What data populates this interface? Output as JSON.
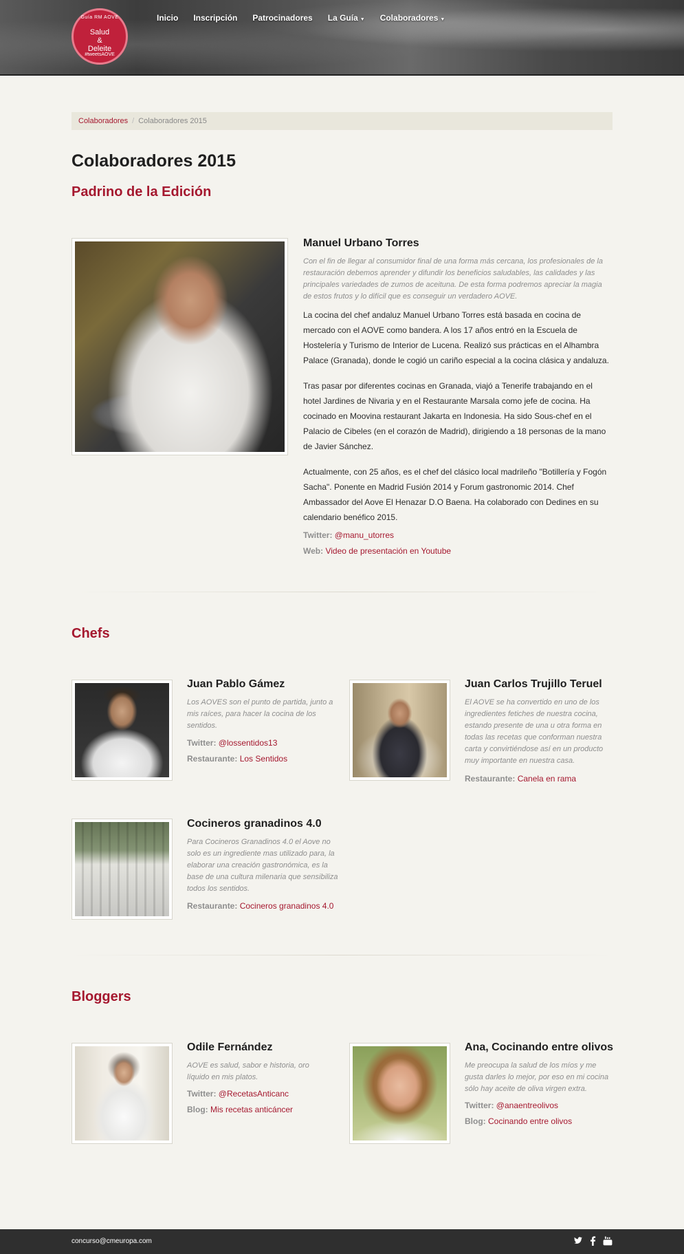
{
  "logo": {
    "top_text": "Guía RM AOVE",
    "line1": "Salud",
    "line2": "&",
    "line3": "Deleite",
    "bottom_text": "#tweetsAOVE"
  },
  "nav": [
    {
      "label": "Inicio"
    },
    {
      "label": "Inscripción"
    },
    {
      "label": "Patrocinadores"
    },
    {
      "label": "La Guía",
      "dropdown": true
    },
    {
      "label": "Colaboradores",
      "dropdown": true
    }
  ],
  "breadcrumb": {
    "link": "Colaboradores",
    "current": "Colaboradores 2015"
  },
  "page_title": "Colaboradores 2015",
  "sections": {
    "padrino": "Padrino de la Edición",
    "chefs": "Chefs",
    "bloggers": "Bloggers"
  },
  "featured": {
    "name": "Manuel Urbano Torres",
    "quote": "Con el fin de llegar al consumidor final de una forma más cercana, los profesionales de la restauración debemos aprender y difundir los beneficios saludables, las calidades y las principales variedades de zumos de aceituna. De esta forma podremos apreciar la magia de estos frutos y lo difícil que es conseguir un verdadero AOVE.",
    "p1": "La cocina del chef andaluz Manuel Urbano Torres está basada en cocina de mercado con el AOVE como bandera. A los 17 años entró en la Escuela de Hostelería y Turismo de Interior de Lucena. Realizó sus prácticas en el Alhambra Palace (Granada), donde le cogió un cariño especial a la cocina clásica y andaluza.",
    "p2": "Tras pasar por diferentes cocinas en Granada, viajó a Tenerife trabajando en el hotel Jardines de Nivaria y en el Restaurante Marsala como jefe de cocina. Ha cocinado en Moovina restaurant Jakarta en Indonesia. Ha sido Sous-chef en el Palacio de Cibeles (en el corazón de Madrid), dirigiendo a 18 personas de la mano de Javier Sánchez.",
    "p3": "Actualmente, con 25 años, es el chef del clásico local madrileño \"Botillería y Fogón Sacha\". Ponente en Madrid Fusión 2014 y Forum gastronomic 2014. Chef Ambassador del Aove El Henazar D.O Baena. Ha colaborado con Dedines en su calendario benéfico 2015.",
    "twitter_label": "Twitter:",
    "twitter": "@manu_utorres",
    "web_label": "Web:",
    "web": "Video de presentación en Youtube"
  },
  "chefs": [
    {
      "name": "Juan Pablo Gámez",
      "quote": "Los AOVES son el punto de partida, junto a mis raíces, para hacer la cocina de los sentidos.",
      "twitter_label": "Twitter:",
      "twitter": "@lossentidos13",
      "rest_label": "Restaurante:",
      "rest": "Los Sentidos"
    },
    {
      "name": "Juan Carlos Trujillo Teruel",
      "quote": "El AOVE se ha convertido en uno de los ingredientes fetiches de nuestra cocina, estando presente de una u otra forma en todas las recetas que conforman nuestra carta y convirtiéndose así en un producto muy importante en nuestra casa.",
      "rest_label": "Restaurante:",
      "rest": "Canela en rama"
    },
    {
      "name": "Cocineros granadinos 4.0",
      "quote": "Para Cocineros Granadinos 4.0 el Aove no solo es un ingrediente mas utilizado para, la elaborar una creación gastronómica, es la base de una cultura milenaria que sensibiliza todos los sentidos.",
      "rest_label": "Restaurante:",
      "rest": "Cocineros granadinos 4.0"
    }
  ],
  "bloggers": [
    {
      "name": "Odile Fernández",
      "quote": "AOVE es salud, sabor e historia, oro líquido en mis platos.",
      "twitter_label": "Twitter:",
      "twitter": "@RecetasAnticanc",
      "blog_label": "Blog:",
      "blog": "Mis recetas anticáncer"
    },
    {
      "name": "Ana, Cocinando entre olivos",
      "quote": "Me preocupa la salud de los míos y me gusta darles lo mejor, por eso en mi cocina sólo hay aceite de oliva virgen extra.",
      "twitter_label": "Twitter:",
      "twitter": "@anaentreolivos",
      "blog_label": "Blog:",
      "blog": "Cocinando entre olivos"
    }
  ],
  "footer": {
    "email": "concurso@cmeuropa.com",
    "icons": [
      "twitter-icon",
      "facebook-icon",
      "youtube-icon"
    ]
  }
}
